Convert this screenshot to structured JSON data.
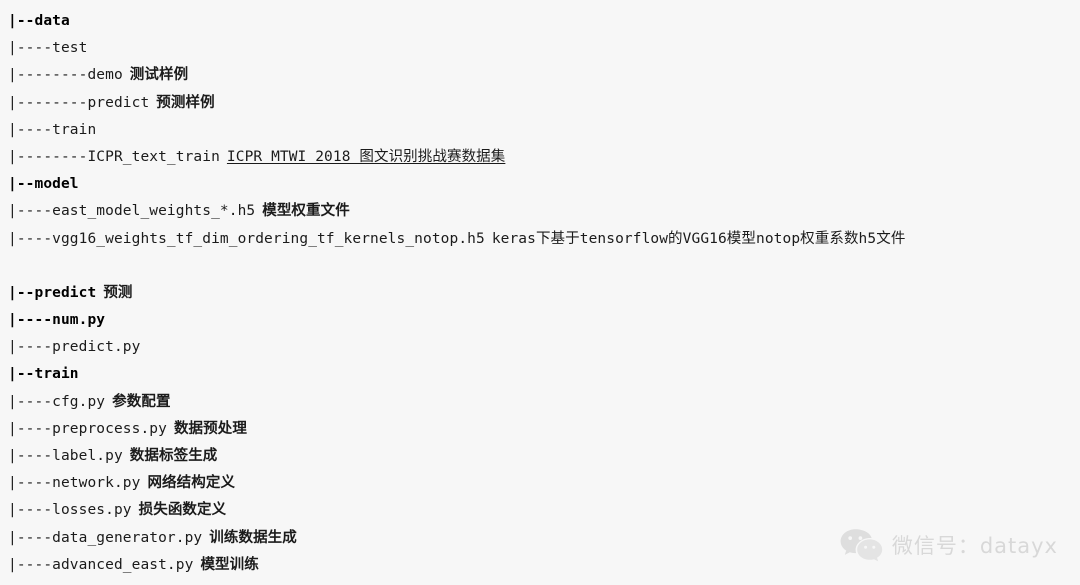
{
  "document": {
    "type": "project-directory-tree",
    "background_color": "#f7f7f7",
    "text_color": "#1b1b1b"
  },
  "tree": {
    "lines": [
      {
        "path": "|--data",
        "desc": "",
        "bold": true,
        "blank": false,
        "link": false
      },
      {
        "path": "|----test",
        "desc": "",
        "bold": false,
        "blank": false,
        "link": false
      },
      {
        "path": "|--------demo",
        "desc": "测试样例",
        "bold": false,
        "blank": false,
        "link": false
      },
      {
        "path": "|--------predict",
        "desc": "预测样例",
        "bold": false,
        "blank": false,
        "link": false
      },
      {
        "path": "|----train",
        "desc": "",
        "bold": false,
        "blank": false,
        "link": false
      },
      {
        "path": "|--------ICPR_text_train",
        "desc": "ICPR MTWI 2018 图文识别挑战赛数据集",
        "bold": false,
        "blank": false,
        "link": true
      },
      {
        "path": "|--model",
        "desc": "",
        "bold": true,
        "blank": false,
        "link": false
      },
      {
        "path": "|----east_model_weights_*.h5",
        "desc": "模型权重文件",
        "bold": false,
        "blank": false,
        "link": false
      },
      {
        "path": "|----vgg16_weights_tf_dim_ordering_tf_kernels_notop.h5",
        "desc": "keras下基于tensorflow的VGG16模型notop权重系数h5文件",
        "bold": false,
        "blank": false,
        "link": false,
        "mixed": true
      },
      {
        "path": "",
        "desc": "",
        "bold": false,
        "blank": true,
        "link": false
      },
      {
        "path": "|--predict",
        "desc": "预测",
        "bold": true,
        "blank": false,
        "link": false
      },
      {
        "path": "|----num.py",
        "desc": "",
        "bold": true,
        "blank": false,
        "link": false
      },
      {
        "path": "|----predict.py",
        "desc": "",
        "bold": false,
        "blank": false,
        "link": false
      },
      {
        "path": "|--train",
        "desc": "",
        "bold": true,
        "blank": false,
        "link": false
      },
      {
        "path": "|----cfg.py",
        "desc": "参数配置",
        "bold": false,
        "blank": false,
        "link": false
      },
      {
        "path": "|----preprocess.py",
        "desc": "数据预处理",
        "bold": false,
        "blank": false,
        "link": false
      },
      {
        "path": "|----label.py",
        "desc": "数据标签生成",
        "bold": false,
        "blank": false,
        "link": false
      },
      {
        "path": "|----network.py",
        "desc": "网络结构定义",
        "bold": false,
        "blank": false,
        "link": false
      },
      {
        "path": "|----losses.py",
        "desc": "损失函数定义",
        "bold": false,
        "blank": false,
        "link": false
      },
      {
        "path": "|----data_generator.py",
        "desc": "训练数据生成",
        "bold": false,
        "blank": false,
        "link": false
      },
      {
        "path": "|----advanced_east.py",
        "desc": "模型训练",
        "bold": false,
        "blank": false,
        "link": false
      }
    ]
  },
  "watermark": {
    "icon": "wechat-logo-icon",
    "text": "微信号：datayx",
    "color": "#d6d6d6"
  }
}
